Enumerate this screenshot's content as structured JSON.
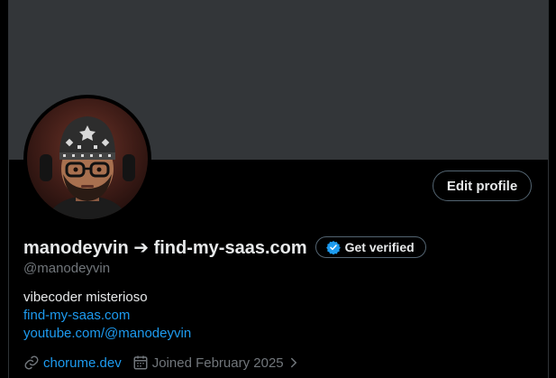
{
  "profile": {
    "display_name": "manodeyvin ➔ find-my-saas.com",
    "handle": "@manodeyvin",
    "bio": "vibecoder misterioso",
    "links": [
      "find-my-saas.com",
      "youtube.com/@manodeyvin"
    ],
    "website": "chorume.dev",
    "joined": "Joined February 2025"
  },
  "actions": {
    "edit_profile": "Edit profile",
    "get_verified": "Get verified"
  },
  "colors": {
    "banner": "#333639",
    "accent": "#1d9bf0",
    "muted": "#71767b",
    "text": "#e7e9ea",
    "border": "#536471"
  },
  "icons": {
    "verified": "verified-badge-icon",
    "link": "link-icon",
    "calendar": "calendar-icon",
    "chevron": "chevron-right-icon"
  }
}
